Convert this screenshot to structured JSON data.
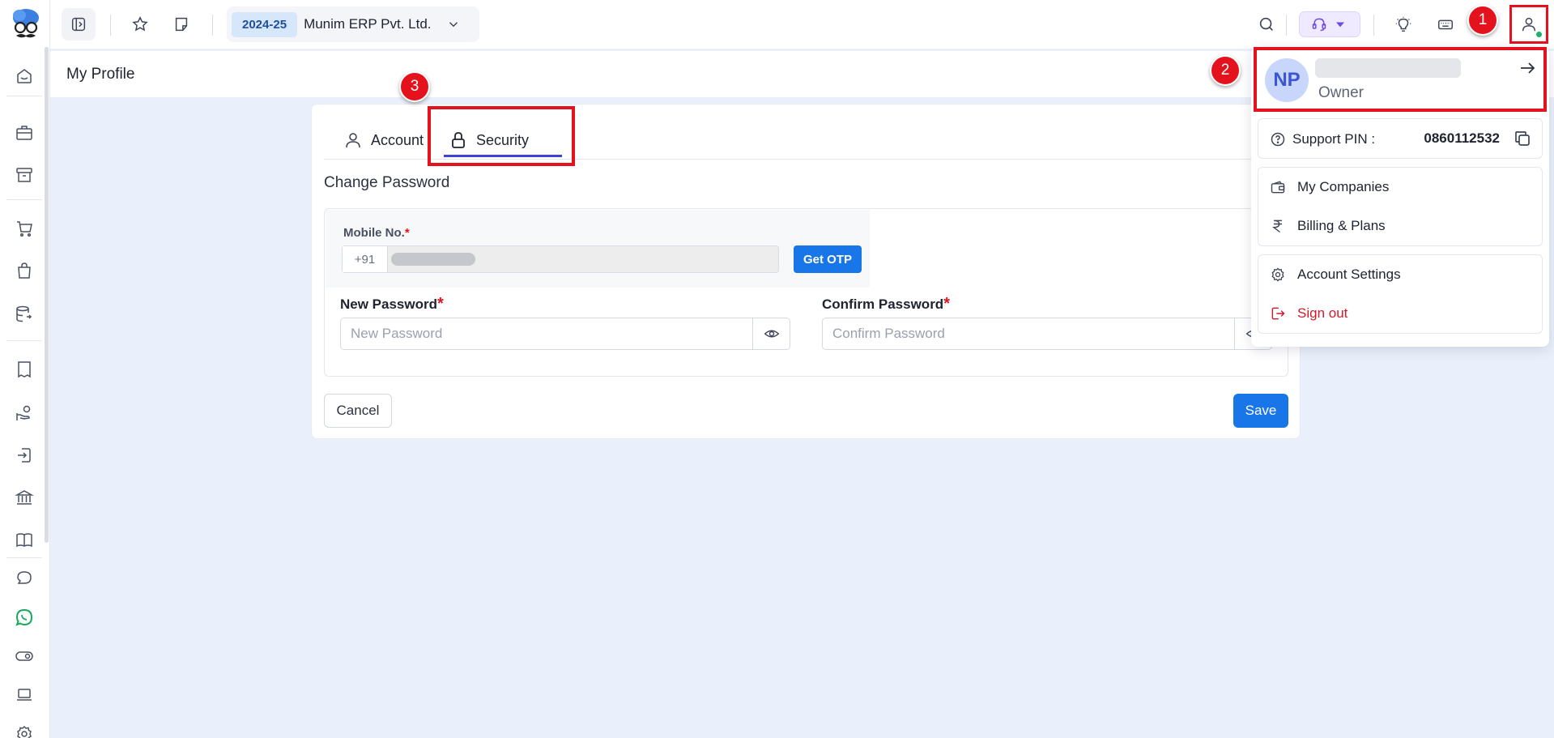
{
  "topbar": {
    "year": "2024-25",
    "company": "Munim ERP Pvt. Ltd."
  },
  "page": {
    "title": "My Profile"
  },
  "tabs": [
    {
      "label": "Account",
      "active": false
    },
    {
      "label": "Security",
      "active": true
    }
  ],
  "change_password": {
    "title": "Change Password",
    "mobile_label": "Mobile No.",
    "required_mark": "*",
    "country_code": "+91",
    "get_otp_label": "Get OTP",
    "new_password_label": "New Password",
    "new_password_placeholder": "New Password",
    "confirm_password_label": "Confirm Password",
    "confirm_password_placeholder": "Confirm Password",
    "cancel_label": "Cancel",
    "save_label": "Save"
  },
  "profile_menu": {
    "initials": "NP",
    "role": "Owner",
    "support_pin_label": "Support PIN :",
    "support_pin_value": "0860112532",
    "items": [
      {
        "label": "My Companies",
        "icon": "wallet-icon"
      },
      {
        "label": "Billing & Plans",
        "icon": "rupee-icon"
      },
      {
        "label": "Account Settings",
        "icon": "gear-icon"
      },
      {
        "label": "Sign out",
        "icon": "logout-icon"
      }
    ]
  },
  "callouts": [
    "1",
    "2",
    "3"
  ],
  "colors": {
    "accent": "#1976e8",
    "tab_underline": "#3c44d6",
    "highlight": "#e4121c",
    "background": "#eaf0fb",
    "signout": "#d11a2a"
  }
}
